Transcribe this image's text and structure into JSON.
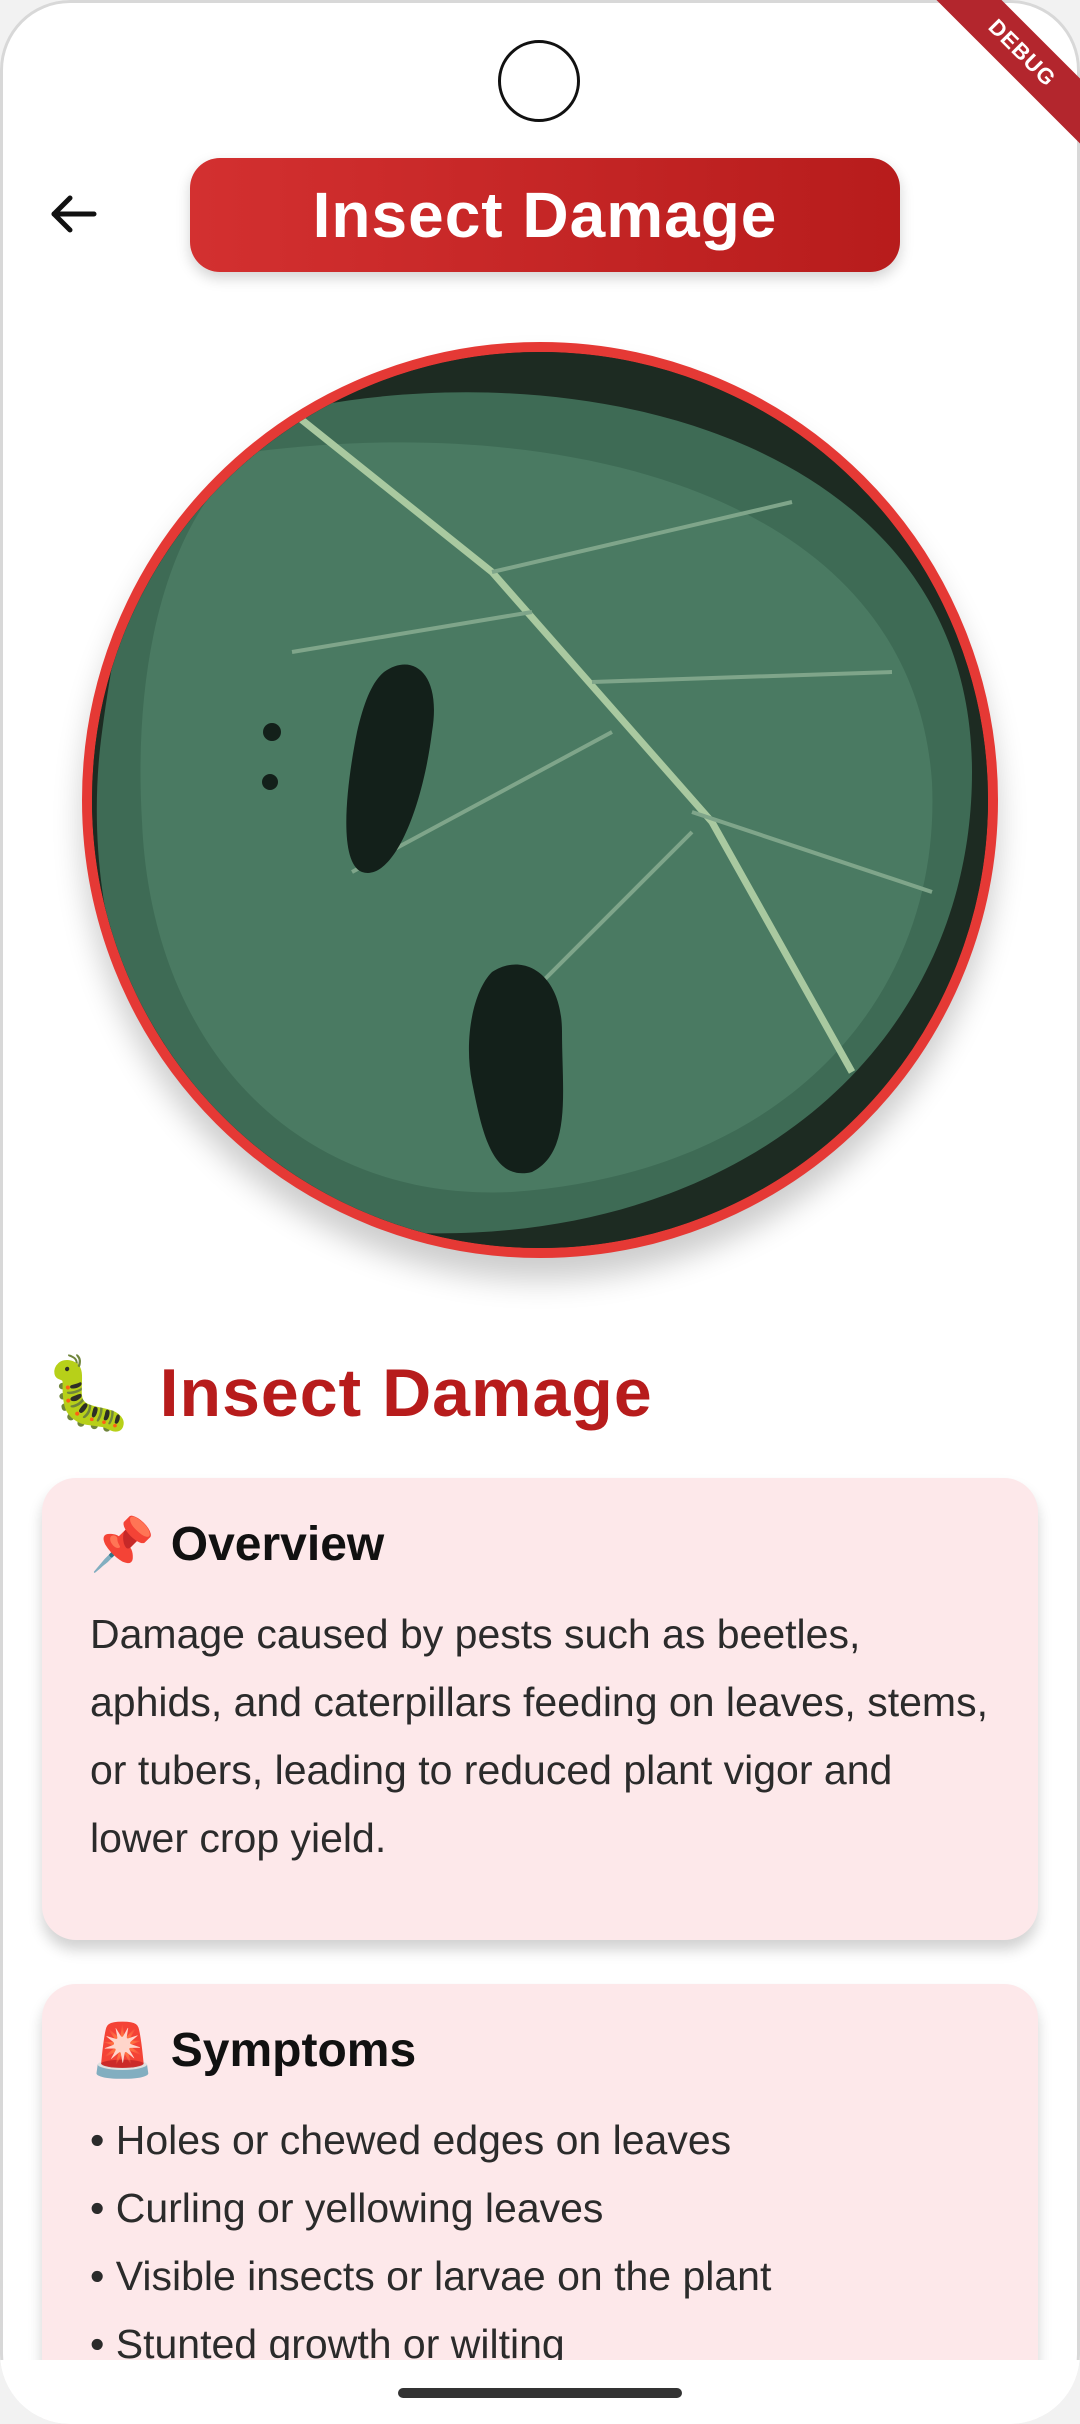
{
  "app": {
    "debug_banner": "DEBUG",
    "title": "Insect Damage"
  },
  "disease": {
    "emoji": "🐛",
    "name": "Insect Damage",
    "accent_color": "#b71c1c",
    "ring_color": "#e53935",
    "card_color": "#fde8ea"
  },
  "overview": {
    "emoji": "📌",
    "title": "Overview",
    "body": "Damage caused by pests such as beetles, aphids, and caterpillars feeding on leaves, stems, or tubers, leading to reduced plant vigor and lower crop yield."
  },
  "symptoms": {
    "emoji": "🚨",
    "title": "Symptoms",
    "items": [
      "• Holes or chewed edges on leaves",
      "• Curling or yellowing leaves",
      "• Visible insects or larvae on the plant",
      "• Stunted growth or wilting"
    ]
  },
  "icons": {
    "back": "arrow-left-icon"
  }
}
